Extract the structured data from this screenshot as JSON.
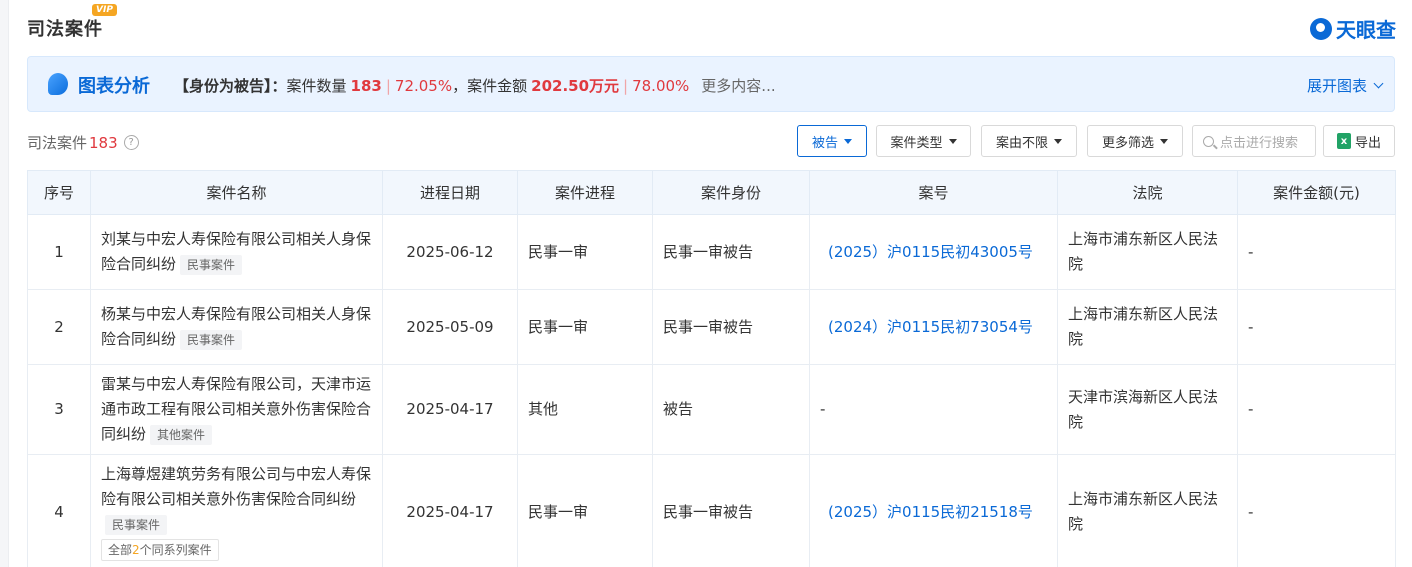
{
  "header": {
    "title": "司法案件",
    "vip_badge": "VIP",
    "brand_name": "天眼查"
  },
  "analysis": {
    "title": "图表分析",
    "role_label": "【身份为被告】：",
    "case_count_label": "案件数量",
    "case_count": "183",
    "case_count_pct": "72.05%",
    "comma": "，",
    "amount_label": "案件金额",
    "amount": "202.50万元",
    "amount_pct": "78.00%",
    "more": "更多内容...",
    "expand": "展开图表"
  },
  "toolbar": {
    "section_label": "司法案件",
    "section_count": "183",
    "help": "?",
    "filter_role": "被告",
    "filter_type": "案件类型",
    "filter_cause": "案由不限",
    "filter_more": "更多筛选",
    "search_placeholder": "点击进行搜索",
    "export": "导出"
  },
  "table": {
    "headers": [
      "序号",
      "案件名称",
      "进程日期",
      "案件进程",
      "案件身份",
      "案号",
      "法院",
      "案件金额(元)"
    ],
    "rows": [
      {
        "no": "1",
        "name": "刘某与中宏人寿保险有限公司相关人身保险合同纠纷",
        "tag": "民事案件",
        "date": "2025-06-12",
        "stage": "民事一审",
        "role": "民事一审被告",
        "case_no": "(2025）沪0115民初43005号",
        "court": "上海市浦东新区人民法院",
        "amount": "-"
      },
      {
        "no": "2",
        "name": "杨某与中宏人寿保险有限公司相关人身保险合同纠纷",
        "tag": "民事案件",
        "date": "2025-05-09",
        "stage": "民事一审",
        "role": "民事一审被告",
        "case_no": "(2024）沪0115民初73054号",
        "court": "上海市浦东新区人民法院",
        "amount": "-"
      },
      {
        "no": "3",
        "name": "雷某与中宏人寿保险有限公司，天津市运通市政工程有限公司相关意外伤害保险合同纠纷",
        "tag": "其他案件",
        "date": "2025-04-17",
        "stage": "其他",
        "role": "被告",
        "case_no": "-",
        "court": "天津市滨海新区人民法院",
        "amount": "-"
      },
      {
        "no": "4",
        "name": "上海尊煜建筑劳务有限公司与中宏人寿保险有限公司相关意外伤害保险合同纠纷",
        "tag": "民事案件",
        "series_prefix": "全部",
        "series_count": "2",
        "series_suffix": "个同系列案件",
        "date": "2025-04-17",
        "stage": "民事一审",
        "role": "民事一审被告",
        "case_no": "(2025）沪0115民初21518号",
        "court": "上海市浦东新区人民法院",
        "amount": "-"
      }
    ]
  },
  "colors": {
    "accent": "#0a69d6",
    "highlight": "#e0393e",
    "header_bg": "#f2f7fd",
    "analysis_bg": "#eaf3ff"
  }
}
